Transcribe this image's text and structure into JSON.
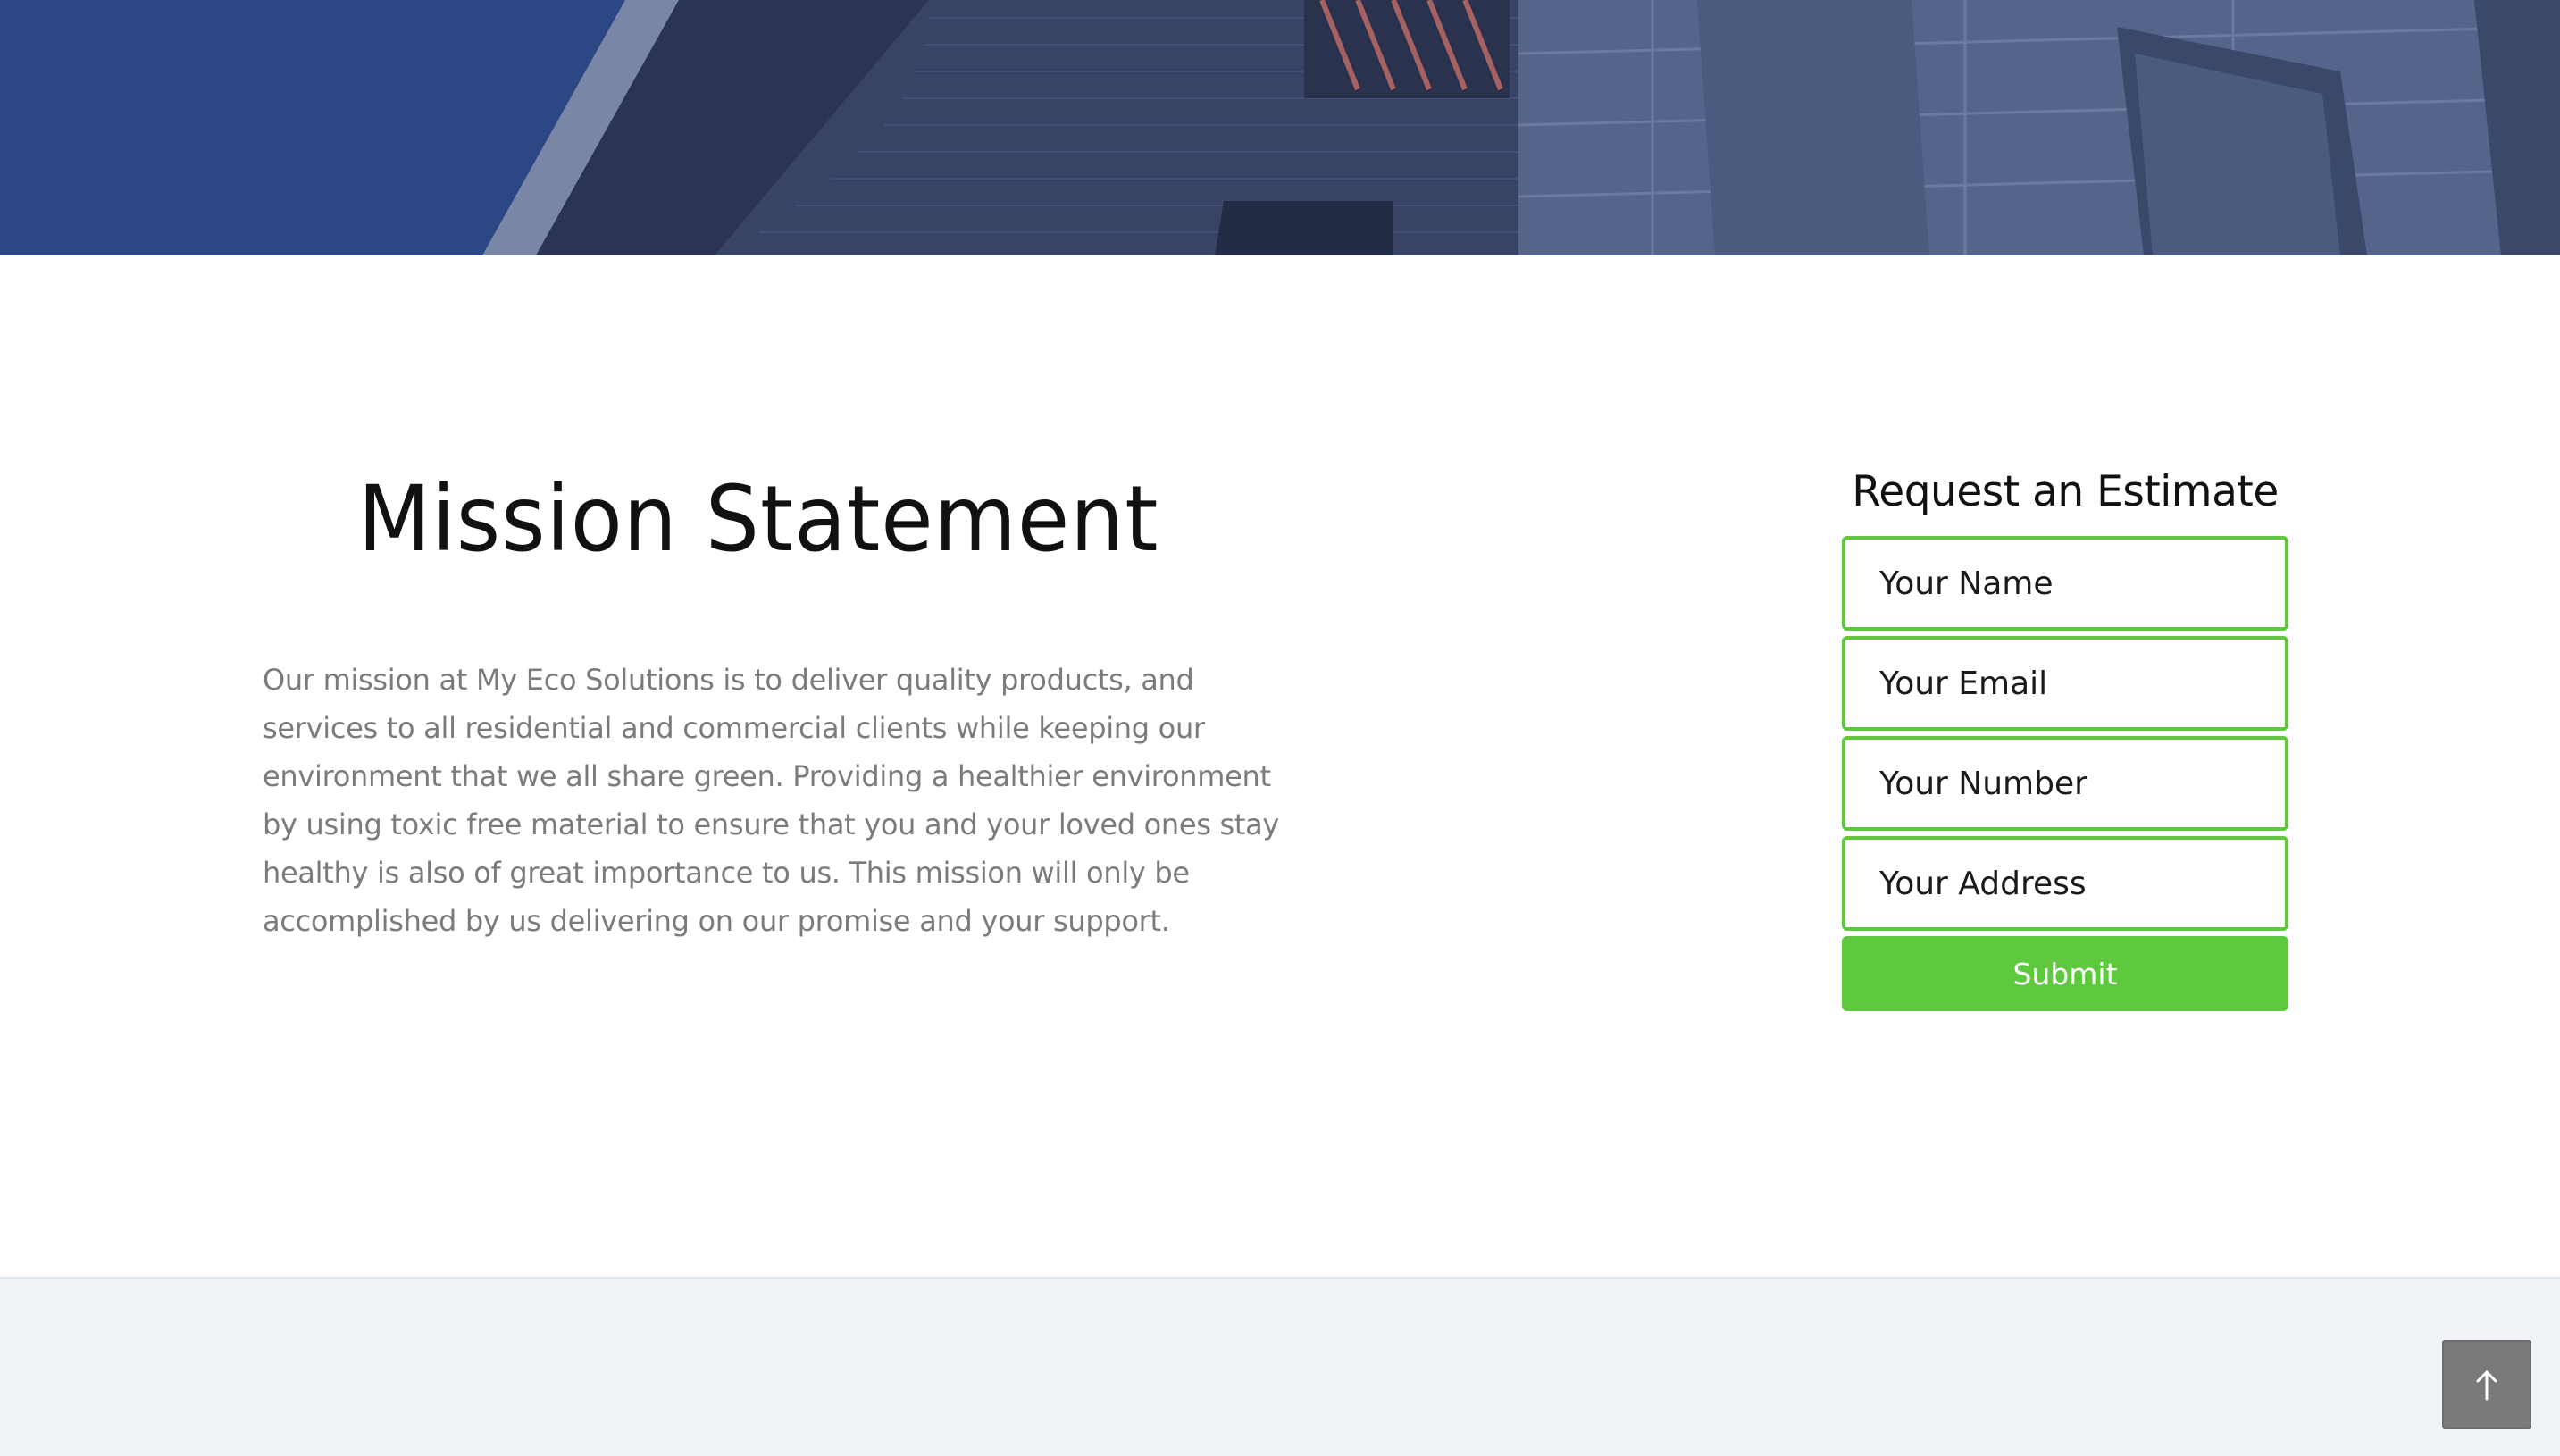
{
  "hero": {
    "image": "building-photo"
  },
  "mission": {
    "title": "Mission Statement",
    "body": "Our mission at My Eco Solutions is to deliver quality products, and services to all residential and commercial clients while keeping our environment that we all share green. Providing a healthier environment by using toxic free material to ensure that you and your loved ones stay healthy is also of great importance to us. This mission will only be accomplished by us delivering on our promise and your support."
  },
  "estimate_form": {
    "title": "Request an Estimate",
    "name_placeholder": "Your Name",
    "email_placeholder": "Your Email",
    "number_placeholder": "Your Number",
    "address_placeholder": "Your Address",
    "submit_label": "Submit"
  },
  "back_to_top": {
    "icon": "arrow-up-icon"
  },
  "colors": {
    "accent_green": "#5ec83f",
    "hero_blue": "#2f4c86",
    "body_text": "#7b7b7b",
    "footer_bg": "#f0f3f8",
    "back_to_top_bg": "#7a7a7a"
  }
}
